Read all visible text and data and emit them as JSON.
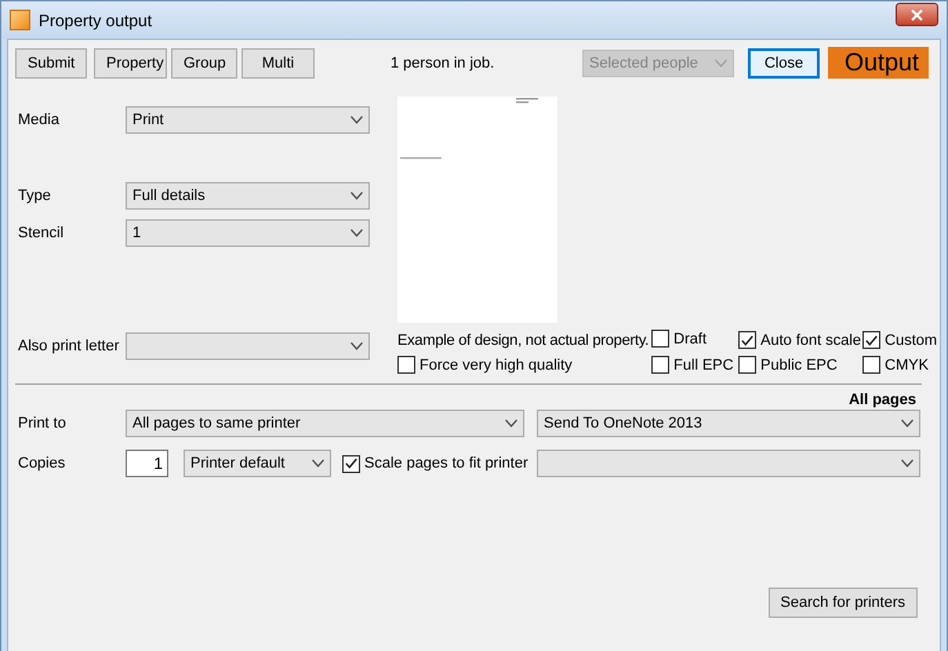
{
  "window": {
    "title": "Property output"
  },
  "toolbar": {
    "buttons": [
      "Submit",
      "Property",
      "Group",
      "Multi"
    ],
    "status": "1 person in job.",
    "people": {
      "value": "Selected people",
      "disabled": true
    },
    "actions": [
      {
        "label": "Close",
        "kind": "focused"
      },
      {
        "label": "Output",
        "kind": "primary"
      }
    ]
  },
  "fields": [
    {
      "label": "Media",
      "value": "Print"
    },
    {
      "label": "Type",
      "value": "Full details"
    },
    {
      "label": "Stencil",
      "value": "1"
    },
    {
      "label": "Also print letter"
    }
  ],
  "preview": {
    "caption": "Example of design, not actual property."
  },
  "options": [
    {
      "label": "Draft",
      "checked": false
    },
    {
      "label": "Auto font scale",
      "checked": true
    },
    {
      "label": "Custom",
      "checked": true
    },
    {
      "label": "Force very high quality",
      "checked": false
    },
    {
      "label": "Full EPC",
      "checked": false
    },
    {
      "label": "Public EPC",
      "checked": false
    },
    {
      "label": "CMYK",
      "checked": false
    }
  ],
  "print": {
    "heading": "All pages",
    "print_to": {
      "label": "Print to",
      "mode": "All pages to same printer",
      "printer": "Send To OneNote 2013"
    },
    "copies": {
      "label": "Copies",
      "value": "1",
      "paper": "Printer default",
      "scale": {
        "label": "Scale pages to fit printer",
        "checked": true
      }
    }
  },
  "search_button": "Search for printers"
}
